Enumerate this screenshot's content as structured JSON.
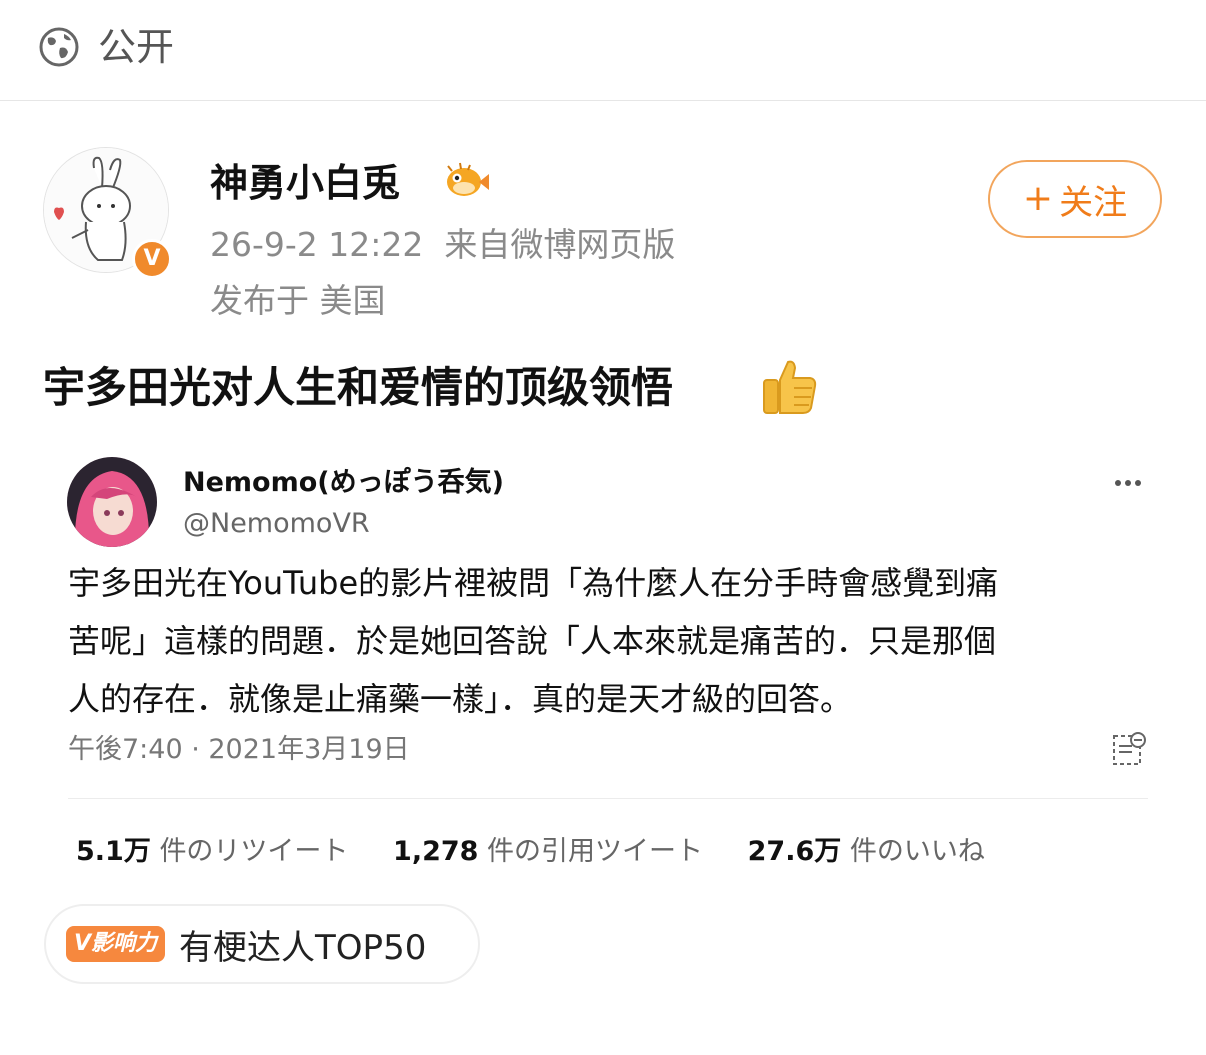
{
  "visibility": {
    "label": "公开",
    "icon": "globe-icon"
  },
  "author": {
    "name": "神勇小白兎",
    "badge": "V",
    "emoji": "pufferfish-emoji",
    "time": "26-9-2 12:22",
    "source": "来自微博网页版",
    "location_prefix": "发布于",
    "location": "美国"
  },
  "follow_button": {
    "plus": "+",
    "label": "关注"
  },
  "post": {
    "text": "宇多田光对人生和爱情的顶级领悟",
    "emoji": "thumbs-up-emoji"
  },
  "tweet": {
    "name": "Nemomo(めっぽう呑気)",
    "handle": "@NemomoVR",
    "body_lines": [
      "宇多田光在YouTube的影片裡被問「為什麼人在分手時會感覺到痛",
      "苦呢」這樣的問題．於是她回答說「人本來就是痛苦的．只是那個",
      "人的存在．就像是止痛藥一樣」．真的是天才級的回答。"
    ],
    "timestamp": "午後7:40 · 2021年3月19日",
    "stats": [
      {
        "value": "5.1万",
        "label": "件のリツイート"
      },
      {
        "value": "1,278",
        "label": "件の引用ツイート"
      },
      {
        "value": "27.6万",
        "label": "件のいいね"
      }
    ]
  },
  "influence_tag": {
    "badge": "V影响力",
    "text": "有梗达人TOP50"
  },
  "colors": {
    "accent": "#f07c1a",
    "badge": "#f08a2c",
    "tag_badge": "#f6883e"
  }
}
